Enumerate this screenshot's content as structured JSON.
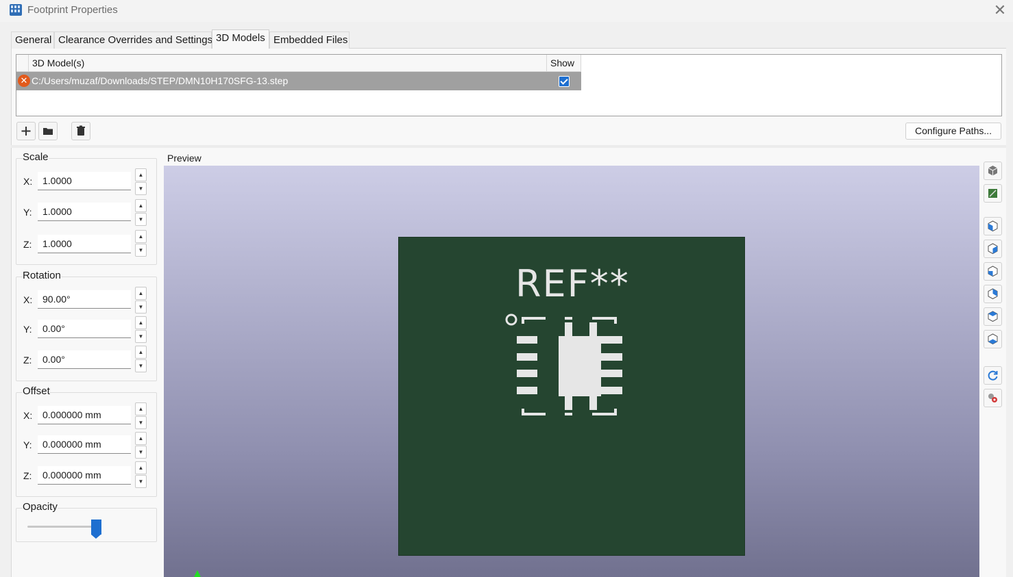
{
  "window": {
    "title": "Footprint Properties"
  },
  "tabs": [
    {
      "label": "General"
    },
    {
      "label": "Clearance Overrides and Settings"
    },
    {
      "label": "3D Models"
    },
    {
      "label": "Embedded Files"
    }
  ],
  "models_table": {
    "col_models": "3D Model(s)",
    "col_show": "Show",
    "rows": [
      {
        "path": "C:/Users/muzaf/Downloads/STEP/DMN10H170SFG-13.step",
        "show": true
      }
    ]
  },
  "toolbar": {
    "configure_label": "Configure Paths..."
  },
  "scale": {
    "title": "Scale",
    "x_label": "X:",
    "y_label": "Y:",
    "z_label": "Z:",
    "x": "1.0000",
    "y": "1.0000",
    "z": "1.0000"
  },
  "rotation": {
    "title": "Rotation",
    "x_label": "X:",
    "y_label": "Y:",
    "z_label": "Z:",
    "x": "90.00°",
    "y": "0.00°",
    "z": "0.00°"
  },
  "offset": {
    "title": "Offset",
    "x_label": "X:",
    "y_label": "Y:",
    "z_label": "Z:",
    "x": "0.000000 mm",
    "y": "0.000000 mm",
    "z": "0.000000 mm"
  },
  "opacity": {
    "title": "Opacity",
    "value": 1.0
  },
  "preview": {
    "label": "Preview",
    "ref_text": "REF**"
  },
  "icons": [
    "app-icon",
    "close-icon",
    "error-icon",
    "add-icon",
    "folder-icon",
    "trash-icon",
    "cube-icon",
    "board-icon",
    "view-front-icon",
    "view-back-icon",
    "view-left-icon",
    "view-right-icon",
    "view-top-icon",
    "view-bottom-icon",
    "refresh-icon",
    "settings-icon"
  ],
  "colors": {
    "accent": "#1e6fd0",
    "board": "#254530",
    "error": "#e25a1c"
  }
}
